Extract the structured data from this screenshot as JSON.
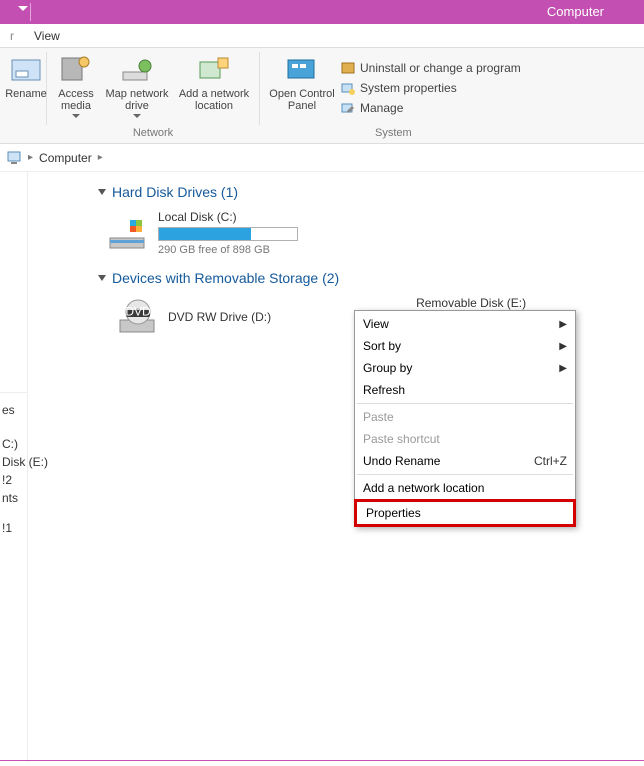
{
  "window": {
    "title": "Computer"
  },
  "tabs": {
    "partial": "r",
    "view": "View"
  },
  "ribbon": {
    "rename": "Rename",
    "access_media": "Access media",
    "map_network_drive": "Map network drive",
    "add_network_location": "Add a network location",
    "open_control_panel": "Open Control Panel",
    "uninstall": "Uninstall or change a program",
    "system_properties": "System properties",
    "manage": "Manage",
    "group_network": "Network",
    "group_system": "System"
  },
  "breadcrumb": {
    "computer": "Computer"
  },
  "sections": {
    "hdd": "Hard Disk Drives (1)",
    "removable": "Devices with Removable Storage (2)"
  },
  "drives": {
    "local": {
      "name": "Local Disk (C:)",
      "free": "290 GB free of 898 GB"
    },
    "dvd": {
      "name": "DVD RW Drive (D:)"
    },
    "removable": {
      "name": "Removable Disk (E:)"
    }
  },
  "sidebar": {
    "item0": "es",
    "item1": "",
    "item2": "C:)",
    "item3": "Disk (E:)",
    "item4": "!2",
    "item5": "nts",
    "item6": "!1"
  },
  "context_menu": {
    "view": "View",
    "sort_by": "Sort by",
    "group_by": "Group by",
    "refresh": "Refresh",
    "paste": "Paste",
    "paste_shortcut": "Paste shortcut",
    "undo_rename": "Undo Rename",
    "undo_shortcut": "Ctrl+Z",
    "add_network_location": "Add a network location",
    "properties": "Properties"
  }
}
